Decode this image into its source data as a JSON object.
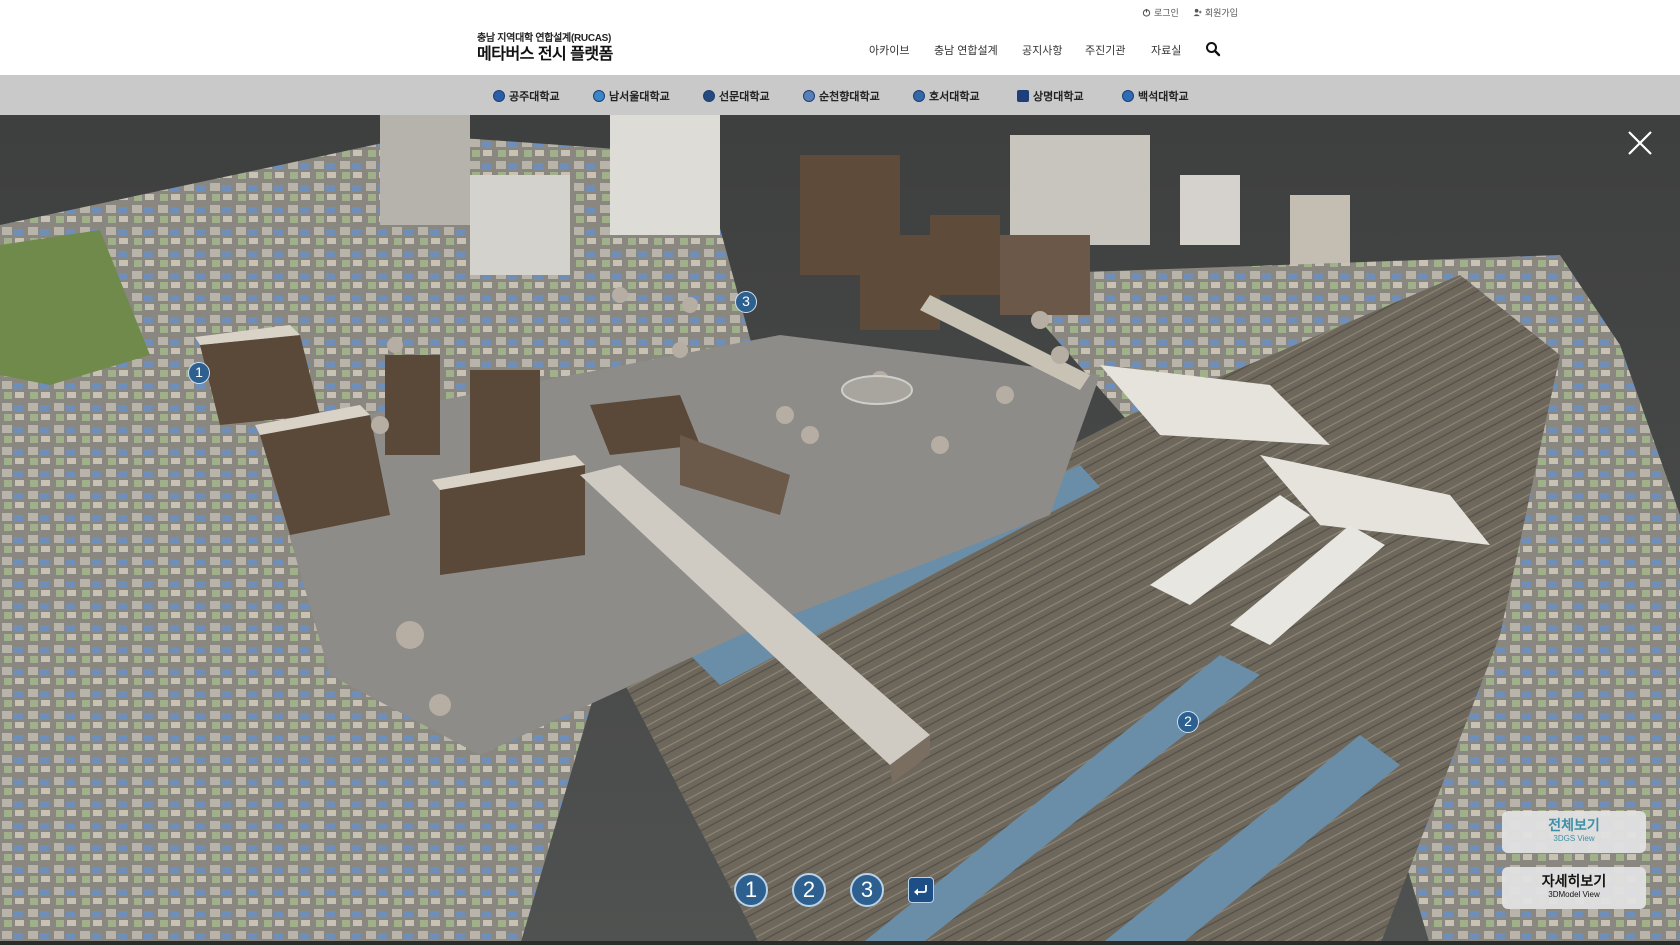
{
  "top_links": {
    "login": "로그인",
    "signup": "회원가입"
  },
  "logo": {
    "line1": "충남 지역대학 연합설계(RUCAS)",
    "line2": "메타버스 전시 플랫폼"
  },
  "main_nav": [
    "아카이브",
    "충남 연합설계",
    "공지사항",
    "주진기관",
    "자료실"
  ],
  "universities": [
    "공주대학교",
    "남서울대학교",
    "선문대학교",
    "순천향대학교",
    "호서대학교",
    "상명대학교",
    "백석대학교"
  ],
  "markers": [
    "1",
    "2",
    "3"
  ],
  "bottom_nav": [
    "1",
    "2",
    "3"
  ],
  "view_buttons": {
    "all": {
      "title": "전체보기",
      "subtitle": "3DGS View"
    },
    "detail": {
      "title": "자세히보기",
      "subtitle": "3DModel View"
    }
  },
  "colors": {
    "accent": "#2d5f8f",
    "uni_bar": "#c9c9c9",
    "view_all_text": "#3f8fa8"
  },
  "icons": {
    "close": "close-icon",
    "search": "search-icon",
    "back": "return-arrow-icon"
  }
}
